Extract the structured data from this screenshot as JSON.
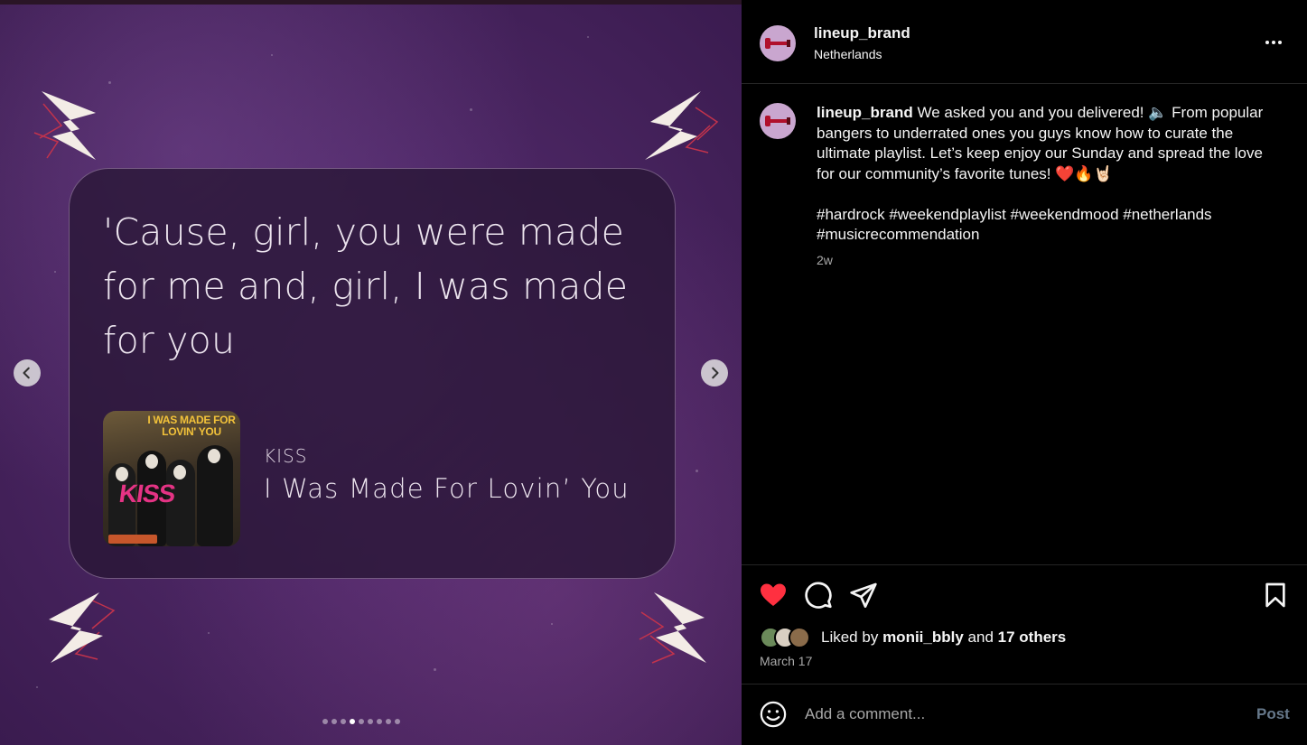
{
  "media": {
    "lyric": "'Cause, girl, you were made for me and, girl, I was made for you",
    "album_cover": {
      "title": "I WAS MADE FOR LOVIN' YOU",
      "logo_text": "KISS"
    },
    "artist": "KISS",
    "song": "I Was Made For Lovin’ You",
    "carousel": {
      "total": 9,
      "active_index": 3
    }
  },
  "post": {
    "username": "lineup_brand",
    "location": "Netherlands",
    "caption": {
      "username": "lineup_brand",
      "text": "We asked you and you delivered! 🔈 From popular bangers to underrated ones you guys know how to curate the ultimate playlist. Let’s keep enjoy our Sunday and spread the love for our community’s favorite tunes! ❤️🔥🤘🏻",
      "hashtags": "#hardrock #weekendplaylist #weekendmood #netherlands #musicrecommendation"
    },
    "age": "2w",
    "likes": {
      "prefix": "Liked by",
      "first_user": "monii_bbly",
      "middle": "and",
      "others": "17 others"
    },
    "date": "March 17",
    "comment": {
      "placeholder": "Add a comment...",
      "post_label": "Post"
    }
  },
  "colors": {
    "like_red": "#ff3040",
    "post_disabled": "#66788a",
    "muted_text": "#a8a8a8"
  },
  "icons": {
    "more": "more-horizontal-icon",
    "like": "heart-filled-icon",
    "comment": "comment-icon",
    "share": "share-paper-plane-icon",
    "save": "bookmark-icon",
    "emoji": "emoji-smile-icon",
    "prev": "chevron-left-icon",
    "next": "chevron-right-icon"
  }
}
